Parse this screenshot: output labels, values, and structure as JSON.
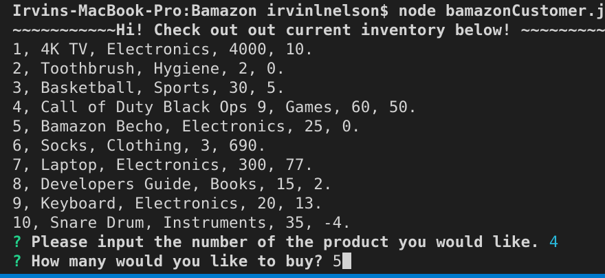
{
  "terminal": {
    "command_line": "Irvins-MacBook-Pro:Bamazon irvinlnelson$ node bamazonCustomer.js",
    "banner": "~~~~~~~~~~~Hi! Check out out current inventory below! ~~~~~~~~~~~",
    "products": [
      "1, 4K TV, Electronics, 4000, 10.",
      "2, Toothbrush, Hygiene, 2, 0.",
      "3, Basketball, Sports, 30, 5.",
      "4, Call of Duty Black Ops 9, Games, 60, 50.",
      "5, Bamazon Becho, Electronics, 25, 0.",
      "6, Socks, Clothing, 3, 690.",
      "7, Laptop, Electronics, 300, 77.",
      "8, Developers Guide, Books, 15, 2.",
      "9, Keyboard, Electronics, 20, 13.",
      "10, Snare Drum, Instruments, 35, -4."
    ],
    "prompt_symbol": "?",
    "question_1": "Please input the number of the product you would like.",
    "answer_1": "4",
    "question_2": "How many would you like to buy?",
    "answer_2": "5"
  },
  "colors": {
    "background": "#1e1e1e",
    "text": "#d4d4d4",
    "prompt_symbol": "#23d18b",
    "answer_accent": "#29b8db",
    "status_bar": "#007acc"
  }
}
